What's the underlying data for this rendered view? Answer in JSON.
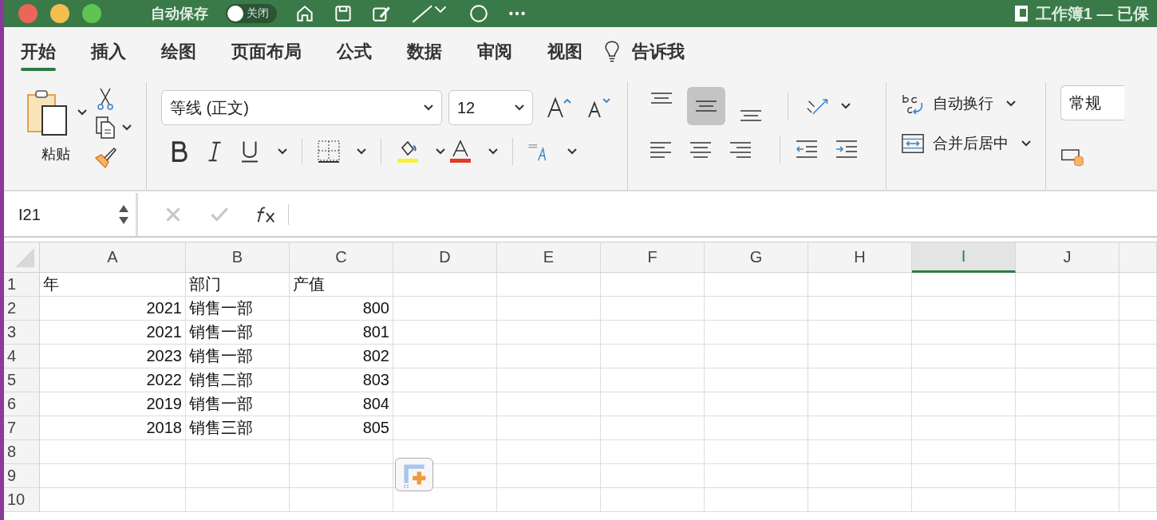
{
  "title_bar": {
    "autosave_label": "自动保存",
    "autosave_toggle": {
      "label": "关闭",
      "on": false
    },
    "document_title": "工作簿1 — 已保"
  },
  "tabs": [
    {
      "label": "开始",
      "selected": true
    },
    {
      "label": "插入",
      "selected": false
    },
    {
      "label": "绘图",
      "selected": false
    },
    {
      "label": "页面布局",
      "selected": false
    },
    {
      "label": "公式",
      "selected": false
    },
    {
      "label": "数据",
      "selected": false
    },
    {
      "label": "审阅",
      "selected": false
    },
    {
      "label": "视图",
      "selected": false
    }
  ],
  "tell_me": "告诉我",
  "ribbon": {
    "paste_label": "粘贴",
    "font_name": "等线 (正文)",
    "font_size": "12",
    "vertical_align": [
      {
        "kind": "top",
        "selected": false
      },
      {
        "kind": "middle",
        "selected": true
      },
      {
        "kind": "bottom",
        "selected": false
      }
    ],
    "wrap_text": "自动换行",
    "merge_center": "合并后居中",
    "number_format": "常规"
  },
  "formula_bar": {
    "name_box": "I21"
  },
  "columns": [
    {
      "label": "A",
      "selected": false
    },
    {
      "label": "B",
      "selected": false
    },
    {
      "label": "C",
      "selected": false
    },
    {
      "label": "D",
      "selected": false
    },
    {
      "label": "E",
      "selected": false
    },
    {
      "label": "F",
      "selected": false
    },
    {
      "label": "G",
      "selected": false
    },
    {
      "label": "H",
      "selected": false
    },
    {
      "label": "I",
      "selected": true
    },
    {
      "label": "J",
      "selected": false
    }
  ],
  "rows": [
    {
      "number": "1",
      "cells": [
        {
          "text": "年",
          "numeric": false
        },
        {
          "text": "部门",
          "numeric": false
        },
        {
          "text": "产值",
          "numeric": false
        }
      ]
    },
    {
      "number": "2",
      "cells": [
        {
          "text": "2021",
          "numeric": true
        },
        {
          "text": "销售一部",
          "numeric": false
        },
        {
          "text": "800",
          "numeric": true
        }
      ]
    },
    {
      "number": "3",
      "cells": [
        {
          "text": "2021",
          "numeric": true
        },
        {
          "text": "销售一部",
          "numeric": false
        },
        {
          "text": "801",
          "numeric": true
        }
      ]
    },
    {
      "number": "4",
      "cells": [
        {
          "text": "2023",
          "numeric": true
        },
        {
          "text": "销售一部",
          "numeric": false
        },
        {
          "text": "802",
          "numeric": true
        }
      ]
    },
    {
      "number": "5",
      "cells": [
        {
          "text": "2022",
          "numeric": true
        },
        {
          "text": "销售二部",
          "numeric": false
        },
        {
          "text": "803",
          "numeric": true
        }
      ]
    },
    {
      "number": "6",
      "cells": [
        {
          "text": "2019",
          "numeric": true
        },
        {
          "text": "销售一部",
          "numeric": false
        },
        {
          "text": "804",
          "numeric": true
        }
      ]
    },
    {
      "number": "7",
      "cells": [
        {
          "text": "2018",
          "numeric": true
        },
        {
          "text": "销售三部",
          "numeric": false
        },
        {
          "text": "805",
          "numeric": true
        }
      ]
    },
    {
      "number": "8",
      "cells": []
    },
    {
      "number": "9",
      "cells": []
    },
    {
      "number": "10",
      "cells": []
    }
  ]
}
